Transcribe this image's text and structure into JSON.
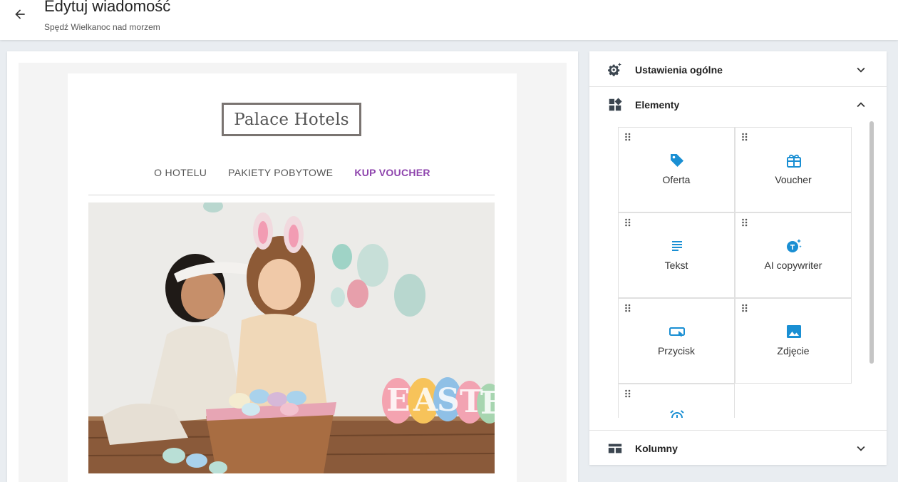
{
  "header": {
    "title": "Edytuj wiadomość",
    "subtitle": "Spędź Wielkanoc nad morzem"
  },
  "email": {
    "logo_text": "Palace Hotels",
    "nav": [
      {
        "label": "O HOTELU"
      },
      {
        "label": "PAKIETY POBYTOWE"
      },
      {
        "label": "KUP VOUCHER"
      }
    ],
    "hero_banner_letters": "EASTE"
  },
  "panel": {
    "general_settings": "Ustawienia ogólne",
    "elements": "Elementy",
    "columns": "Kolumny",
    "tiles": [
      {
        "label": "Oferta",
        "icon": "tag-icon"
      },
      {
        "label": "Voucher",
        "icon": "gift-icon"
      },
      {
        "label": "Tekst",
        "icon": "text-lines-icon"
      },
      {
        "label": "AI copywriter",
        "icon": "ai-sparkle-icon"
      },
      {
        "label": "Przycisk",
        "icon": "button-click-icon"
      },
      {
        "label": "Zdjęcie",
        "icon": "image-icon"
      },
      {
        "label": "",
        "icon": "alarm-clock-icon"
      }
    ]
  },
  "colors": {
    "accent": "#1a8fd3",
    "nav_active": "#8e44ad",
    "icon_dark": "#3c4650"
  }
}
